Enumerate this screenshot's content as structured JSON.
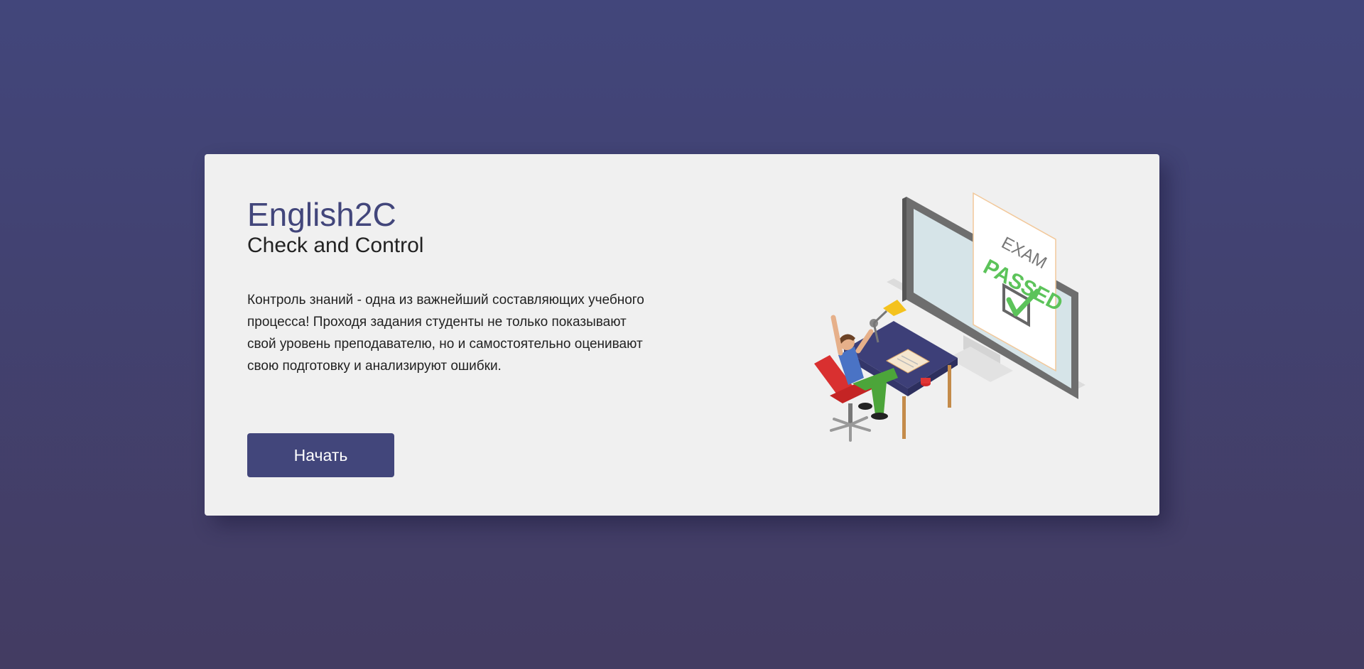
{
  "hero": {
    "title": "English2C",
    "subtitle": "Check and Control",
    "description": "Контроль знаний - одна из важнейший составляющих учебного процесса! Проходя задания студенты не только показывают свой уровень преподавателю, но и самостоятельно оценивают свою подготовку и анализируют ошибки.",
    "start_label": "Начать"
  },
  "illustration": {
    "exam_text": "EXAM",
    "passed_text": "PASSED"
  },
  "colors": {
    "accent": "#42467b",
    "card_bg": "#f0f0f0",
    "passed_green": "#5cc35a"
  }
}
